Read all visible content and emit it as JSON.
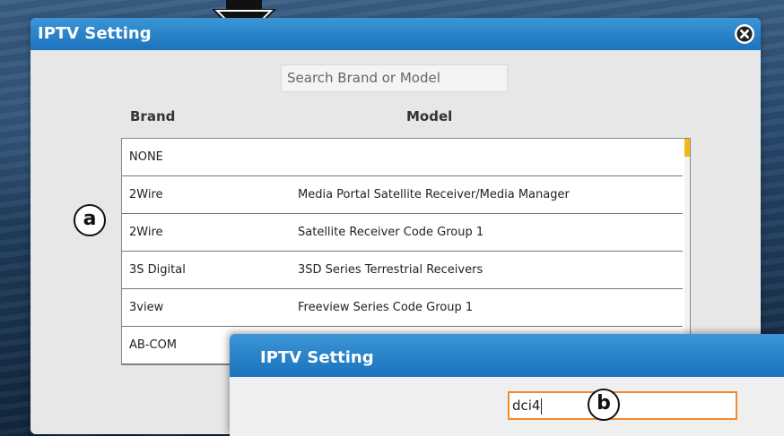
{
  "colors": {
    "title_bar": "#1a73bd",
    "accent_orange": "#f28a2a",
    "scroll_thumb": "#f0b81c"
  },
  "dialog_main": {
    "title": "IPTV Setting",
    "close_icon": "close-circle-icon",
    "search": {
      "placeholder": "Search Brand or Model",
      "value": ""
    },
    "headers": {
      "brand": "Brand",
      "model": "Model"
    },
    "rows": [
      {
        "brand": "NONE",
        "model": ""
      },
      {
        "brand": "2Wire",
        "model": "Media Portal Satellite Receiver/Media Manager"
      },
      {
        "brand": "2Wire",
        "model": "Satellite Receiver Code Group 1"
      },
      {
        "brand": "3S Digital",
        "model": "3SD Series Terrestrial Receivers"
      },
      {
        "brand": "3view",
        "model": "Freeview Series Code Group 1"
      },
      {
        "brand": "AB-COM",
        "model": ""
      }
    ]
  },
  "callouts": {
    "a": "a",
    "b": "b"
  },
  "dialog_secondary": {
    "title": "IPTV Setting",
    "search": {
      "value": "dci4"
    }
  }
}
